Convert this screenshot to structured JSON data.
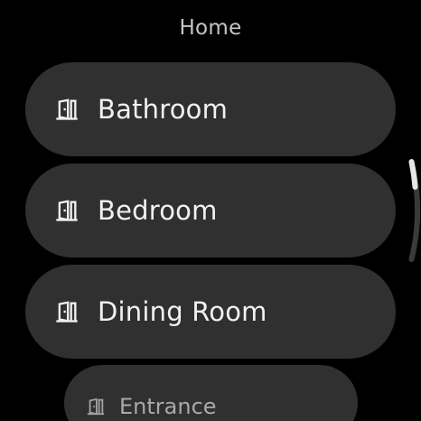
{
  "header": {
    "title": "Home"
  },
  "rooms": [
    {
      "label": "Bathroom",
      "icon": "door-icon"
    },
    {
      "label": "Bedroom",
      "icon": "door-icon"
    },
    {
      "label": "Dining Room",
      "icon": "door-icon"
    },
    {
      "label": "Entrance",
      "icon": "door-icon"
    }
  ],
  "colors": {
    "background": "#000000",
    "chip": "#303030",
    "text": "#f1f1f1",
    "title": "#c6c6c6",
    "scroll_track": "#3a3a3a",
    "scroll_thumb": "#e6e6e6"
  },
  "scroll": {
    "position_fraction": 0.1,
    "thumb_fraction": 0.25
  }
}
